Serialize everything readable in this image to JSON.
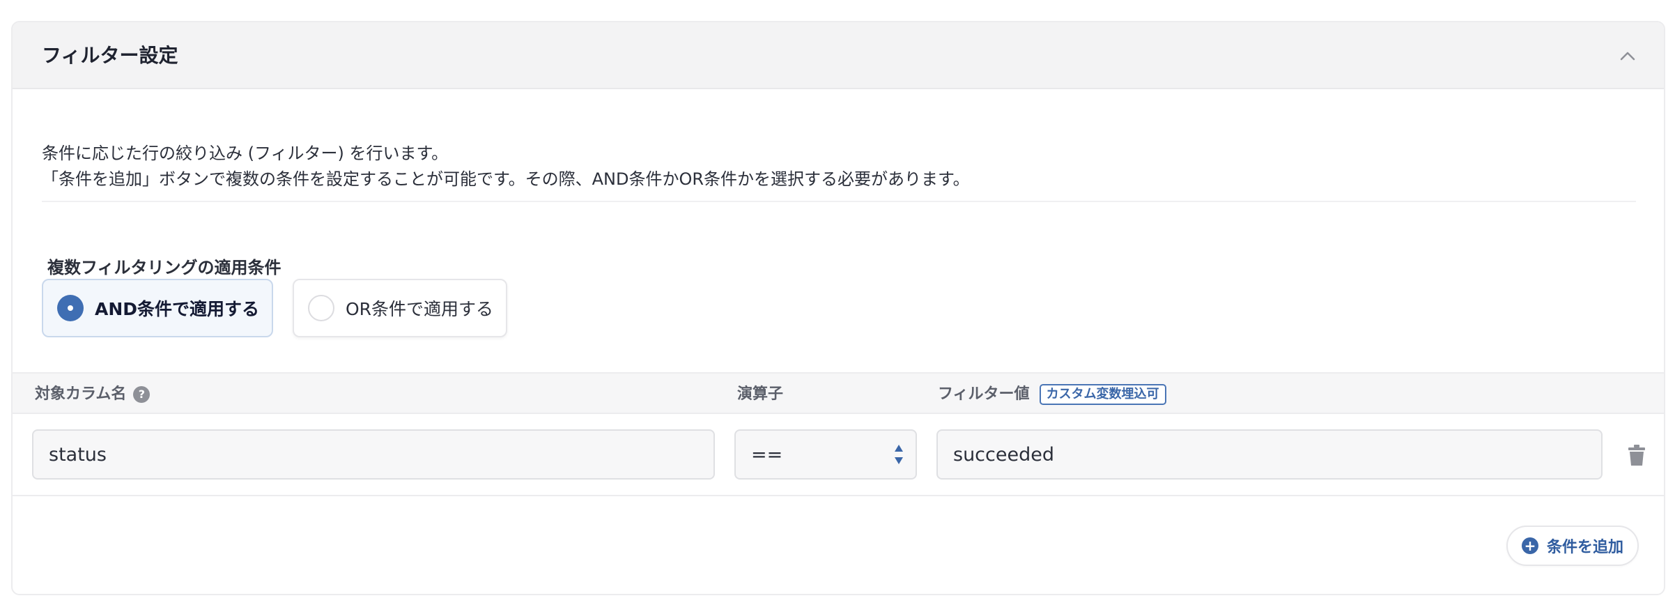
{
  "panel": {
    "title": "フィルター設定",
    "collapse_icon": "chevron-up-icon"
  },
  "description": {
    "line1": "条件に応じた行の絞り込み (フィルター) を行います。",
    "line2": "「条件を追加」ボタンで複数の条件を設定することが可能です。その際、AND条件かOR条件かを選択する必要があります。"
  },
  "match_mode": {
    "label": "複数フィルタリングの適用条件",
    "options": [
      {
        "label": "AND条件で適用する",
        "selected": true
      },
      {
        "label": "OR条件で適用する",
        "selected": false
      }
    ]
  },
  "table": {
    "headers": {
      "column": "対象カラム名",
      "operator": "演算子",
      "value": "フィルター値",
      "value_badge": "カスタム変数埋込可"
    },
    "help_icon": "?",
    "rows": [
      {
        "column": "status",
        "operator": "==",
        "value": "succeeded"
      }
    ]
  },
  "add_button": {
    "label": "条件を追加",
    "icon": "+"
  },
  "colors": {
    "accent": "#3f6eb3",
    "header_bg": "#f3f3f4"
  }
}
